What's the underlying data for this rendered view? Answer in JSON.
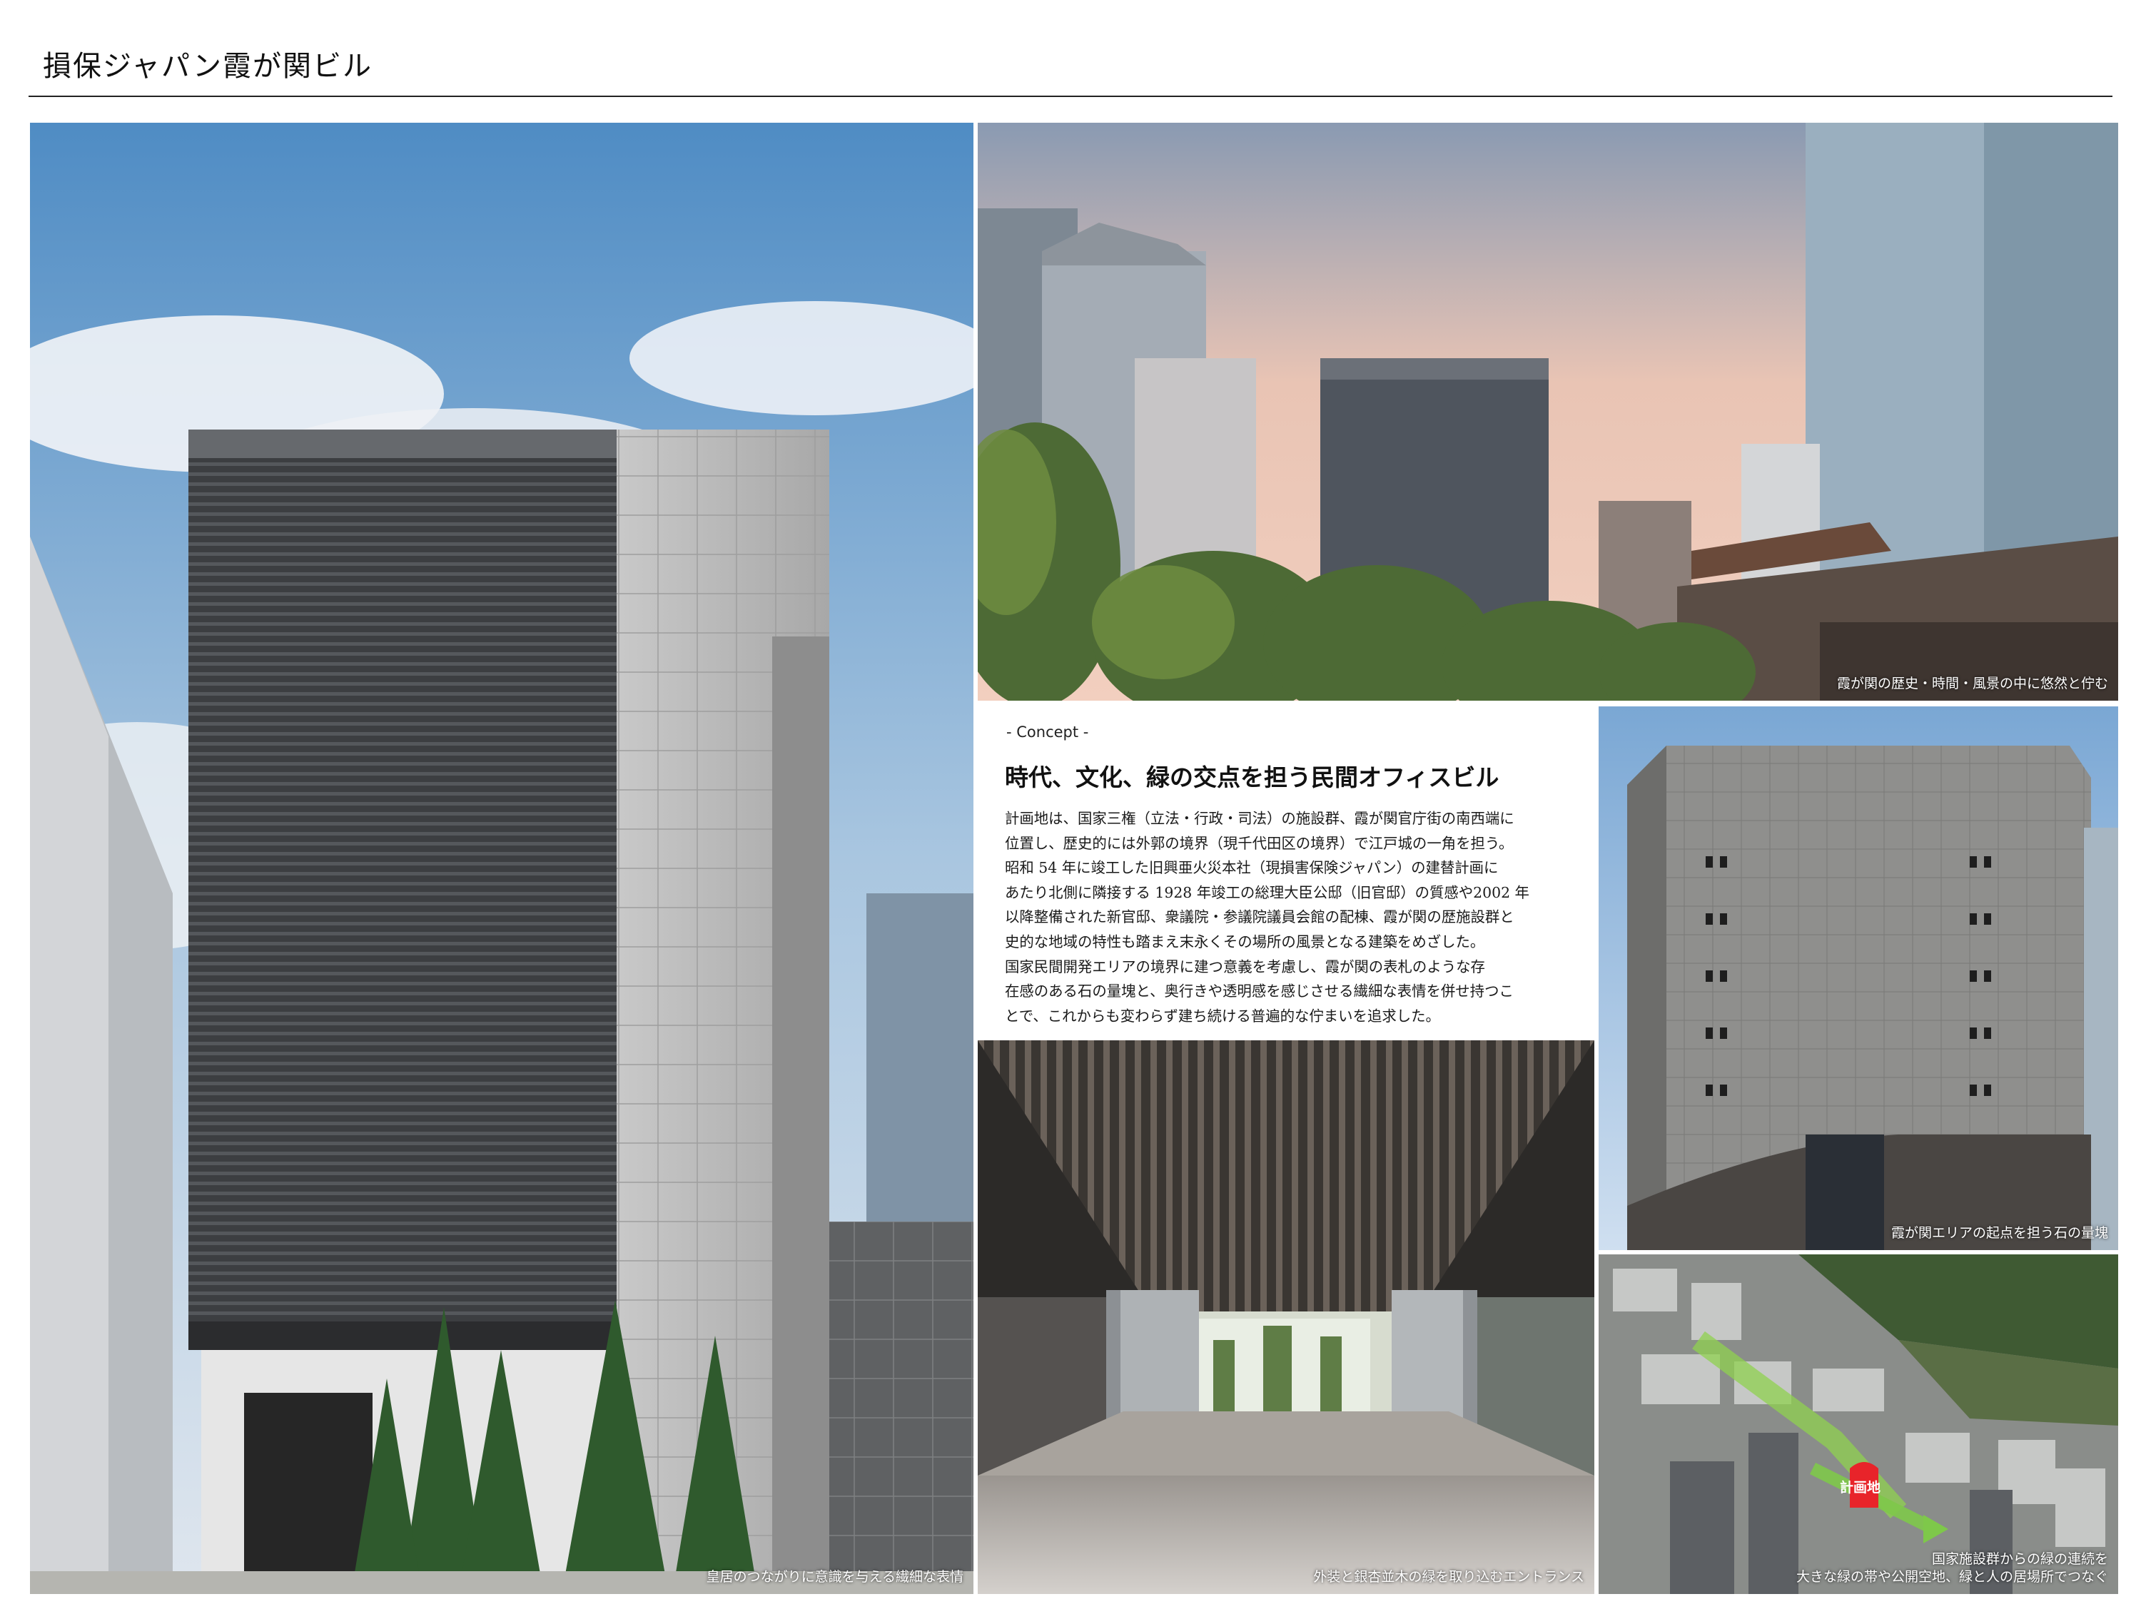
{
  "page": {
    "title": "損保ジャパン霞が関ビル"
  },
  "photos": [
    {
      "caption": "皇居のつながりに意識を与える繊細な表情"
    },
    {
      "caption": "霞が関の歴史・時間・風景の中に悠然と佇む"
    },
    {
      "caption": "外装と銀杏並木の緑を取り込むエントランス"
    },
    {
      "caption": "霞が関エリアの起点を担う石の量塊"
    },
    {
      "caption_line1": "国家施設群からの緑の連続を",
      "caption_line2": "大きな緑の帯や公開空地、緑と人の居場所でつなぐ",
      "site_label": "計画地"
    }
  ],
  "concept": {
    "label": "- Concept -",
    "heading": "時代、文化、緑の交点を担う民間オフィスビル",
    "lines": [
      "計画地は、国家三権（立法・行政・司法）の施設群、霞が関官庁街の南西端に",
      "位置し、歴史的には外郭の境界（現千代田区の境界）で江戸城の一角を担う。",
      "昭和 54 年に竣工した旧興亜火災本社（現損害保険ジャパン）の建替計画に",
      "あたり北側に隣接する 1928 年竣工の総理大臣公邸（旧官邸）の質感や2002 年",
      "以降整備された新官邸、衆議院・参議院議員会館の配棟、霞が関の歴施設群と",
      "史的な地域の特性も踏まえ末永くその場所の風景となる建築をめざした。",
      "国家民間開発エリアの境界に建つ意義を考慮し、霞が関の表札のような存",
      "在感のある石の量塊と、奥行きや透明感を感じさせる繊細な表情を併せ持つこ",
      "とで、これからも変わらず建ち続ける普遍的な佇まいを追求した。"
    ]
  },
  "colors": {
    "accent_red": "#e8242a",
    "green_path": "#8fd14f"
  }
}
